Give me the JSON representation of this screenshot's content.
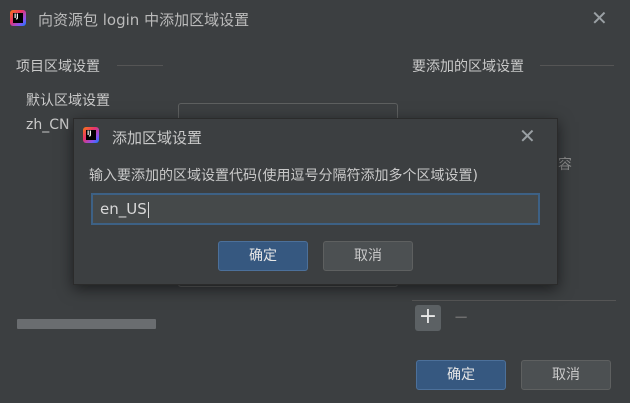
{
  "main_window": {
    "title": "向资源包 login 中添加区域设置",
    "project_locales_label": "项目区域设置",
    "locales_to_add_label": "要添加的区域设置",
    "project_locales": [
      "默认区域设置",
      "zh_CN"
    ],
    "right_panel_partial_text": "内容",
    "add_icon": "+",
    "remove_icon": "−",
    "ok_label": "确定",
    "cancel_label": "取消"
  },
  "dialog": {
    "title": "添加区域设置",
    "prompt": "输入要添加的区域设置代码(使用逗号分隔符添加多个区域设置)",
    "input_value": "en_US",
    "ok_label": "确定",
    "cancel_label": "取消"
  },
  "colors": {
    "background": "#3c3f41",
    "primary_button": "#365880",
    "secondary_button": "#4c5052",
    "input_focus_border": "#3d6185"
  }
}
